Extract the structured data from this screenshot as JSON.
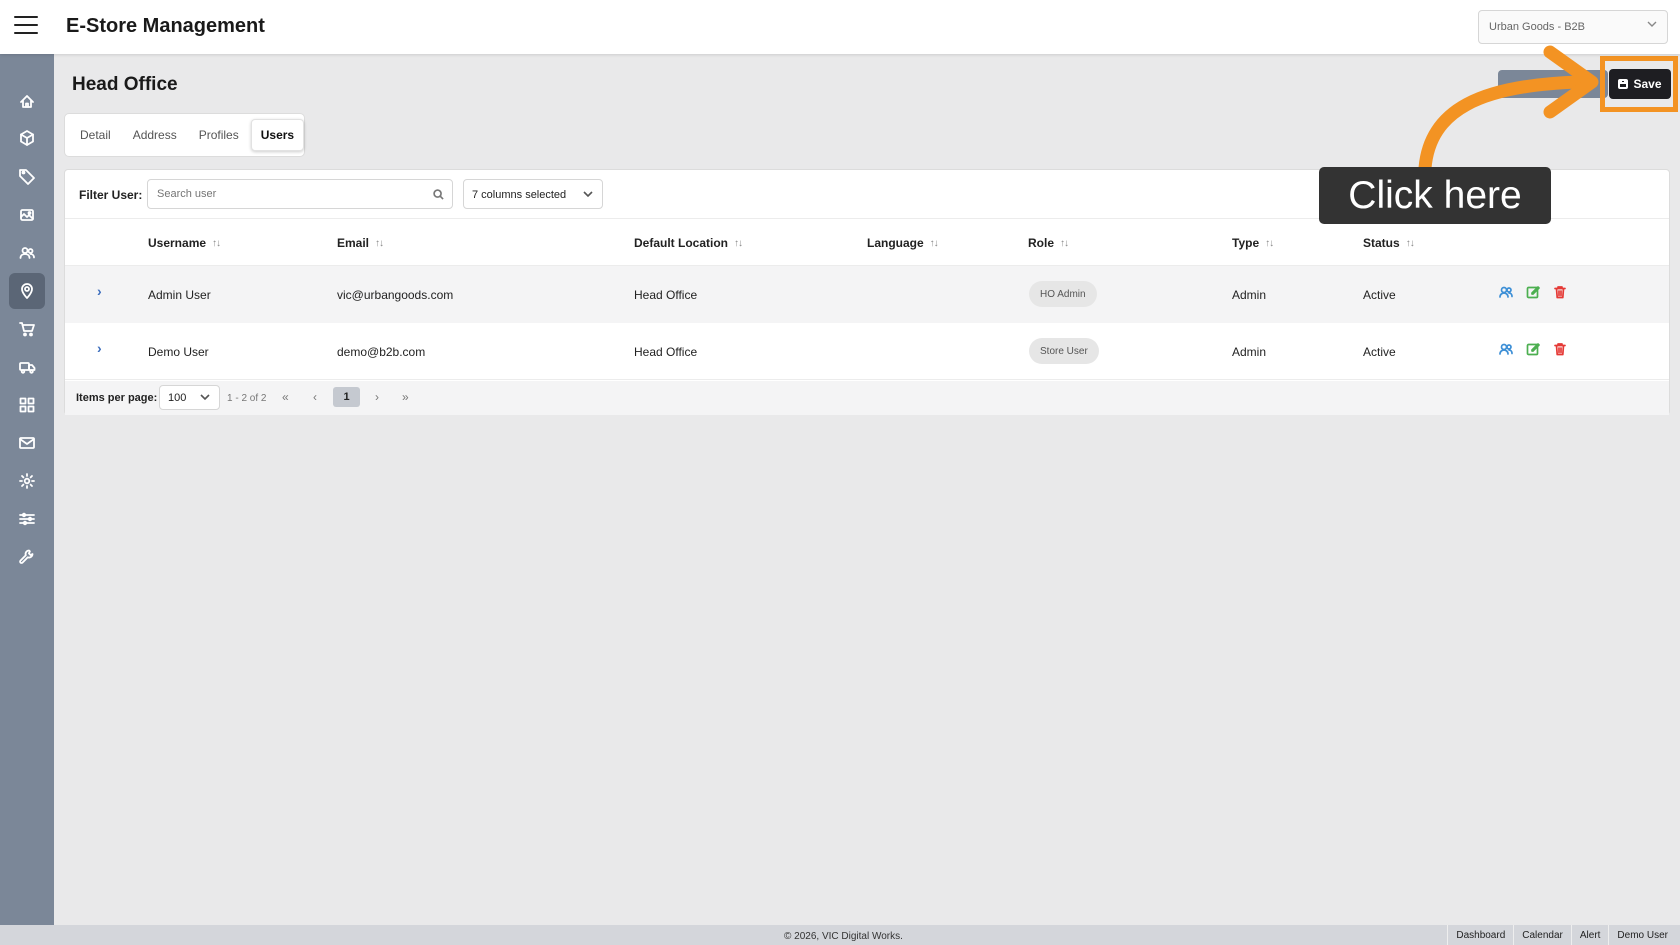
{
  "header": {
    "app_title": "E-Store Management",
    "store_selector": "Urban Goods - B2B"
  },
  "sidebar": {
    "items": [
      {
        "icon": "home-icon"
      },
      {
        "icon": "box-icon"
      },
      {
        "icon": "tag-icon"
      },
      {
        "icon": "images-icon"
      },
      {
        "icon": "users-icon"
      },
      {
        "icon": "location-pin-icon",
        "active": true
      },
      {
        "icon": "cart-icon"
      },
      {
        "icon": "truck-icon"
      },
      {
        "icon": "grid-icon"
      },
      {
        "icon": "mail-icon"
      },
      {
        "icon": "gear-icon"
      },
      {
        "icon": "sliders-icon"
      },
      {
        "icon": "wrench-icon"
      }
    ]
  },
  "page": {
    "title": "Head Office",
    "save_label": "Save"
  },
  "tabs": [
    {
      "label": "Detail"
    },
    {
      "label": "Address"
    },
    {
      "label": "Profiles"
    },
    {
      "label": "Users",
      "active": true
    }
  ],
  "filter": {
    "label": "Filter User:",
    "search_placeholder": "Search user",
    "columns_selected": "7 columns selected"
  },
  "table": {
    "columns": [
      "Username",
      "Email",
      "Default Location",
      "Language",
      "Role",
      "Type",
      "Status"
    ],
    "sort_glyph": "↑↓",
    "rows": [
      {
        "username": "Admin User",
        "email": "vic@urbangoods.com",
        "location": "Head Office",
        "language": "",
        "role": "HO Admin",
        "type": "Admin",
        "status": "Active"
      },
      {
        "username": "Demo User",
        "email": "demo@b2b.com",
        "location": "Head Office",
        "language": "",
        "role": "Store User",
        "type": "Admin",
        "status": "Active"
      }
    ]
  },
  "pagination": {
    "items_per_page_label": "Items per page:",
    "items_per_page": "100",
    "range": "1 - 2 of 2",
    "current_page": "1"
  },
  "callout": {
    "text": "Click here",
    "accent_color": "#f39323"
  },
  "footer": {
    "copyright": "© 2026, VIC Digital Works.",
    "links": [
      "Dashboard",
      "Calendar",
      "Alert",
      "Demo User"
    ]
  }
}
